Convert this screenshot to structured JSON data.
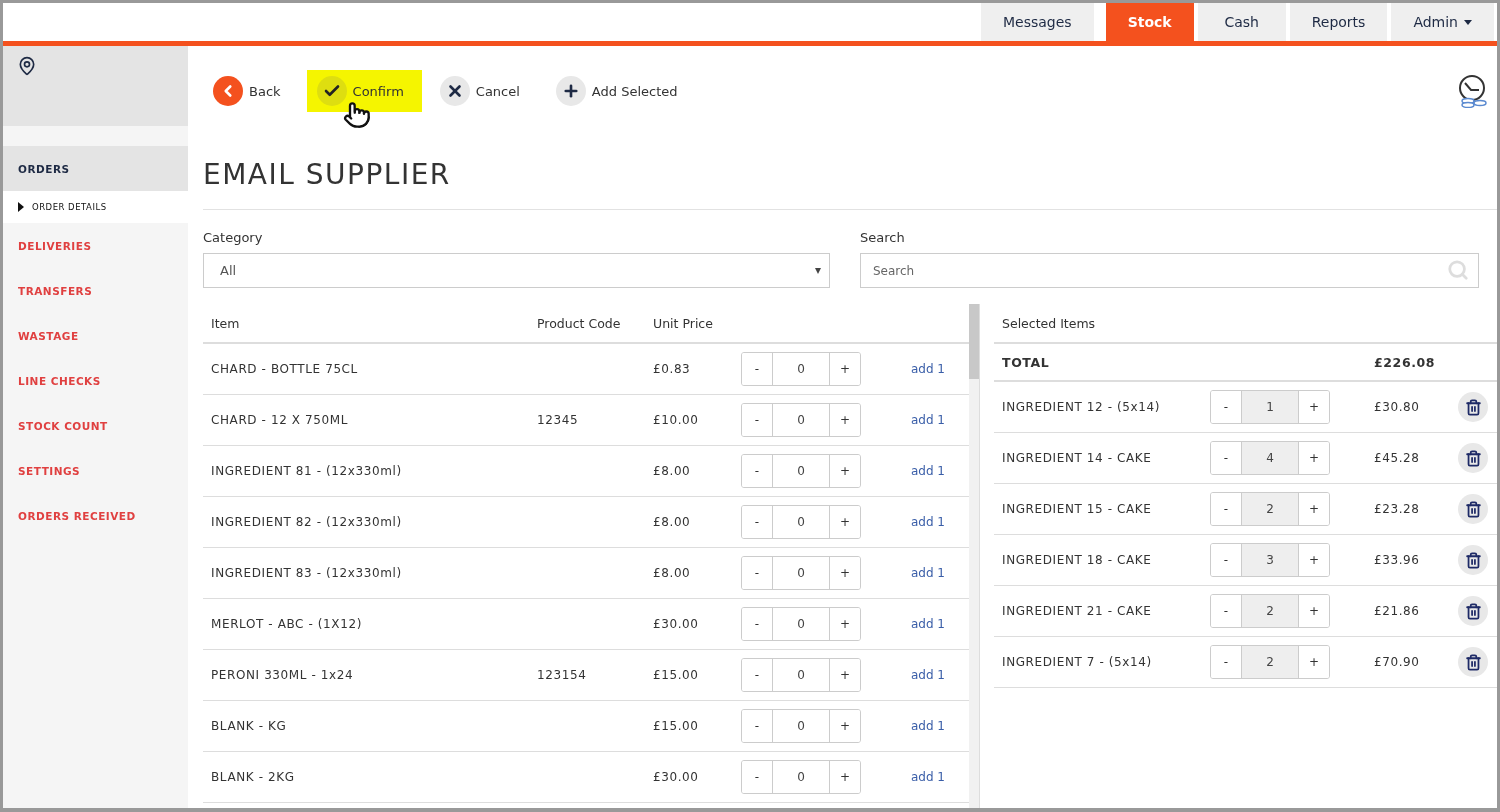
{
  "nav": {
    "tabs": [
      {
        "label": "Messages",
        "selected": false,
        "dropdown": false
      },
      {
        "label": "Stock",
        "selected": true,
        "dropdown": false
      },
      {
        "label": "Cash",
        "selected": false,
        "dropdown": false
      },
      {
        "label": "Reports",
        "selected": false,
        "dropdown": false
      },
      {
        "label": "Admin",
        "selected": false,
        "dropdown": true
      }
    ]
  },
  "sidebar": {
    "items": [
      {
        "label": "ORDERS",
        "selected": true,
        "children": [
          {
            "label": "ORDER DETAILS",
            "selected": true
          }
        ]
      },
      {
        "label": "DELIVERIES",
        "selected": false
      },
      {
        "label": "TRANSFERS",
        "selected": false
      },
      {
        "label": "WASTAGE",
        "selected": false
      },
      {
        "label": "LINE CHECKS",
        "selected": false
      },
      {
        "label": "STOCK COUNT",
        "selected": false
      },
      {
        "label": "SETTINGS",
        "selected": false
      },
      {
        "label": "ORDERS RECEIVED",
        "selected": false
      }
    ]
  },
  "toolbar": {
    "buttons": [
      {
        "kind": "back",
        "label": "Back",
        "highlighted": false
      },
      {
        "kind": "confirm",
        "label": "Confirm",
        "highlighted": true
      },
      {
        "kind": "cancel",
        "label": "Cancel",
        "highlighted": false
      },
      {
        "kind": "add",
        "label": "Add Selected",
        "highlighted": false
      }
    ]
  },
  "title": "EMAIL SUPPLIER",
  "filters": {
    "category": {
      "label": "Category",
      "value": "All"
    },
    "search": {
      "label": "Search",
      "placeholder": "Search"
    }
  },
  "items_table": {
    "columns": [
      "Item",
      "Product Code",
      "Unit Price"
    ],
    "rows": [
      {
        "item": "CHARD - BOTTLE 75CL",
        "code": "",
        "price": "£0.83",
        "qty": "0",
        "action": "add 1"
      },
      {
        "item": "CHARD - 12 X 750ML",
        "code": "12345",
        "price": "£10.00",
        "qty": "0",
        "action": "add 1"
      },
      {
        "item": "INGREDIENT 81 - (12x330ml)",
        "code": "",
        "price": "£8.00",
        "qty": "0",
        "action": "add 1"
      },
      {
        "item": "INGREDIENT 82 - (12x330ml)",
        "code": "",
        "price": "£8.00",
        "qty": "0",
        "action": "add 1"
      },
      {
        "item": "INGREDIENT 83 - (12x330ml)",
        "code": "",
        "price": "£8.00",
        "qty": "0",
        "action": "add 1"
      },
      {
        "item": "MERLOT - ABC - (1X12)",
        "code": "",
        "price": "£30.00",
        "qty": "0",
        "action": "add 1"
      },
      {
        "item": "PERONI 330ML - 1x24",
        "code": "123154",
        "price": "£15.00",
        "qty": "0",
        "action": "add 1"
      },
      {
        "item": "BLANK - KG",
        "code": "",
        "price": "£15.00",
        "qty": "0",
        "action": "add 1"
      },
      {
        "item": "BLANK - 2KG",
        "code": "",
        "price": "£30.00",
        "qty": "0",
        "action": "add 1"
      }
    ]
  },
  "selected_items": {
    "heading": "Selected Items",
    "total_label": "TOTAL",
    "total": "£226.08",
    "rows": [
      {
        "item": "INGREDIENT 12 - (5x14)",
        "qty": "1",
        "price": "£30.80"
      },
      {
        "item": "INGREDIENT 14 - CAKE",
        "qty": "4",
        "price": "£45.28"
      },
      {
        "item": "INGREDIENT 15 - CAKE",
        "qty": "2",
        "price": "£23.28"
      },
      {
        "item": "INGREDIENT 18 - CAKE",
        "qty": "3",
        "price": "£33.96"
      },
      {
        "item": "INGREDIENT 21 - CAKE",
        "qty": "2",
        "price": "£21.86"
      },
      {
        "item": "INGREDIENT 7 - (5x14)",
        "qty": "2",
        "price": "£70.90"
      }
    ]
  },
  "stepper": {
    "minus": "-",
    "plus": "+"
  }
}
